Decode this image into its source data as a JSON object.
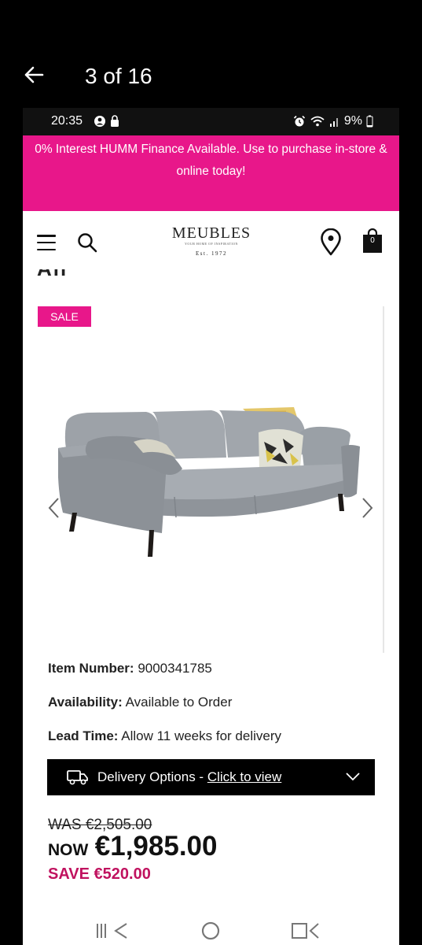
{
  "viewer": {
    "counter": "3 of 16",
    "back_icon": "arrow-left-icon"
  },
  "status_bar": {
    "time": "20:35",
    "battery": "9%",
    "icons": [
      "account-icon",
      "lock-icon",
      "alarm-icon",
      "wifi-icon",
      "signal-icon",
      "battery-icon"
    ]
  },
  "promo": {
    "text": "0% Interest HUMM Finance Available. Use to purchase in-store & online today!"
  },
  "header": {
    "logo_name": "MEUBLES",
    "logo_tagline": "YOUR HOME OF INSPIRATION",
    "logo_est": "Est. 1972",
    "cart_count": "0",
    "icons": [
      "menu-icon",
      "search-icon",
      "location-pin-icon",
      "shopping-bag-icon"
    ]
  },
  "product": {
    "badge": "SALE",
    "cut_heading": "All Fabrics",
    "details": [
      {
        "label": "Item Number:",
        "value": "9000341785"
      },
      {
        "label": "Availability:",
        "value": "Available to Order"
      },
      {
        "label": "Lead Time:",
        "value": "Allow 11 weeks for delivery"
      }
    ],
    "delivery": {
      "text": "Delivery Options - ",
      "link": "Click to view"
    },
    "price": {
      "was": "WAS €2,505.00",
      "now_label": "NOW",
      "now": "€1,985.00",
      "save": "SAVE €520.00"
    }
  },
  "colors": {
    "brand_pink": "#e8178a",
    "save_red": "#c0125f"
  }
}
